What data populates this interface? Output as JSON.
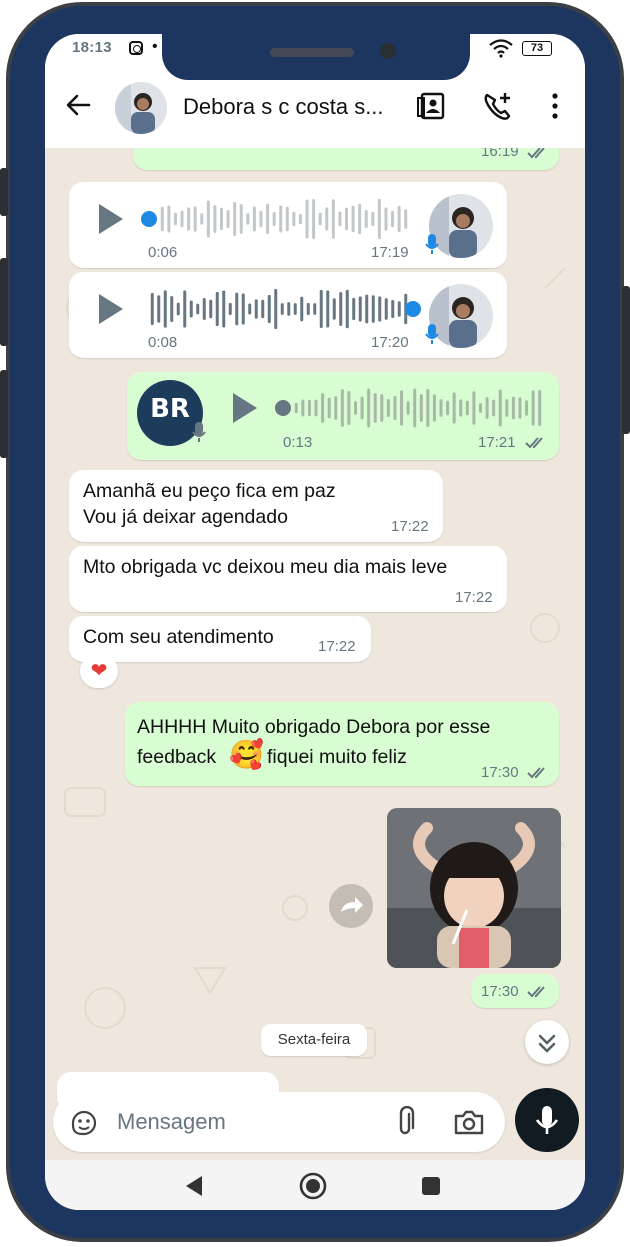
{
  "status_bar": {
    "time": "18:13",
    "battery": "73"
  },
  "header": {
    "contact_name": "Debora s c costa s..."
  },
  "messages": {
    "m0": {
      "time": "16:19"
    },
    "v1": {
      "duration": "0:06",
      "time": "17:19",
      "progress": 0.0
    },
    "v2": {
      "duration": "0:08",
      "time": "17:20",
      "progress": 1.0
    },
    "v3": {
      "duration": "0:13",
      "time": "17:21",
      "logo_text": "BR",
      "progress": 0.0
    },
    "t1": {
      "line1": "Amanhã eu peço fica em paz",
      "line2": "Vou já deixar agendado",
      "time": "17:22"
    },
    "t2": {
      "text": "Mto obrigada vc deixou meu dia mais leve",
      "time": "17:22"
    },
    "t3": {
      "text": "Com seu atendimento",
      "time": "17:22",
      "reaction": "❤"
    },
    "t4": {
      "line1": "AHHHH Muito obrigado Debora por esse",
      "line2a": "feedback",
      "emoji": "🥰",
      "line2b": "fiquei muito feliz",
      "time": "17:30"
    },
    "p1": {
      "time": "17:30"
    }
  },
  "date_separator": "Sexta-feira",
  "composer": {
    "placeholder": "Mensagem"
  },
  "colors": {
    "outgoing": "#d9fdd3",
    "incoming": "#ffffff",
    "background": "#efe7dd",
    "accent_blue": "#1e88e5",
    "frame": "#1d3660"
  },
  "icons": [
    "back-arrow-icon",
    "contacts-book-icon",
    "add-call-icon",
    "more-vertical-icon",
    "play-icon",
    "microphone-icon",
    "double-check-icon",
    "forward-icon",
    "chevron-double-down-icon",
    "sticker-icon",
    "attach-icon",
    "camera-icon",
    "nav-back-icon",
    "nav-home-icon",
    "nav-recents-icon"
  ]
}
